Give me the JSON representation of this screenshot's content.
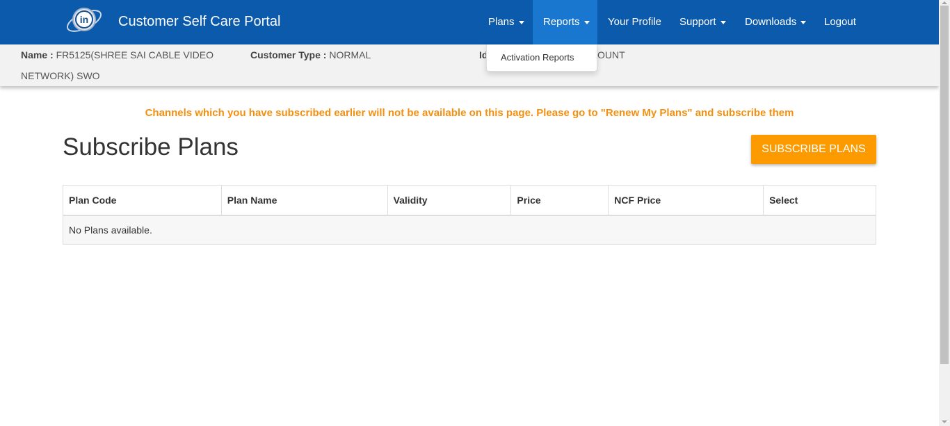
{
  "header": {
    "brand": "Customer Self Care Portal",
    "logo_text": "in",
    "nav": [
      {
        "label": "Plans",
        "has_caret": true
      },
      {
        "label": "Reports",
        "has_caret": true,
        "active": true
      },
      {
        "label": "Your Profile",
        "has_caret": false
      },
      {
        "label": "Support",
        "has_caret": true
      },
      {
        "label": "Downloads",
        "has_caret": true
      },
      {
        "label": "Logout",
        "has_caret": false
      }
    ]
  },
  "reports_dropdown": {
    "items": [
      "Activation Reports"
    ]
  },
  "customer_info": {
    "name_label": "Name :",
    "name_value_line1": "FR5125(SHREE SAI CABLE VIDEO",
    "name_value_line2": "NETWORK) SWO",
    "type_label": "Customer Type :",
    "type_value": "NORMAL",
    "id_label_visible": "Id",
    "id_value_visible": "OUNT"
  },
  "notice": "Channels which you have subscribed earlier will not be available on this page. Please go to \"Renew My Plans\" and subscribe them",
  "page": {
    "title": "Subscribe Plans",
    "subscribe_button": "SUBSCRIBE PLANS"
  },
  "table": {
    "headers": [
      "Plan Code",
      "Plan Name",
      "Validity",
      "Price",
      "NCF Price",
      "Select"
    ],
    "empty_message": "No Plans available."
  },
  "colors": {
    "navbar": "#0b5aab",
    "nav_active": "#1a77cf",
    "notice": "#f58f10",
    "button": "#fd9a00"
  }
}
